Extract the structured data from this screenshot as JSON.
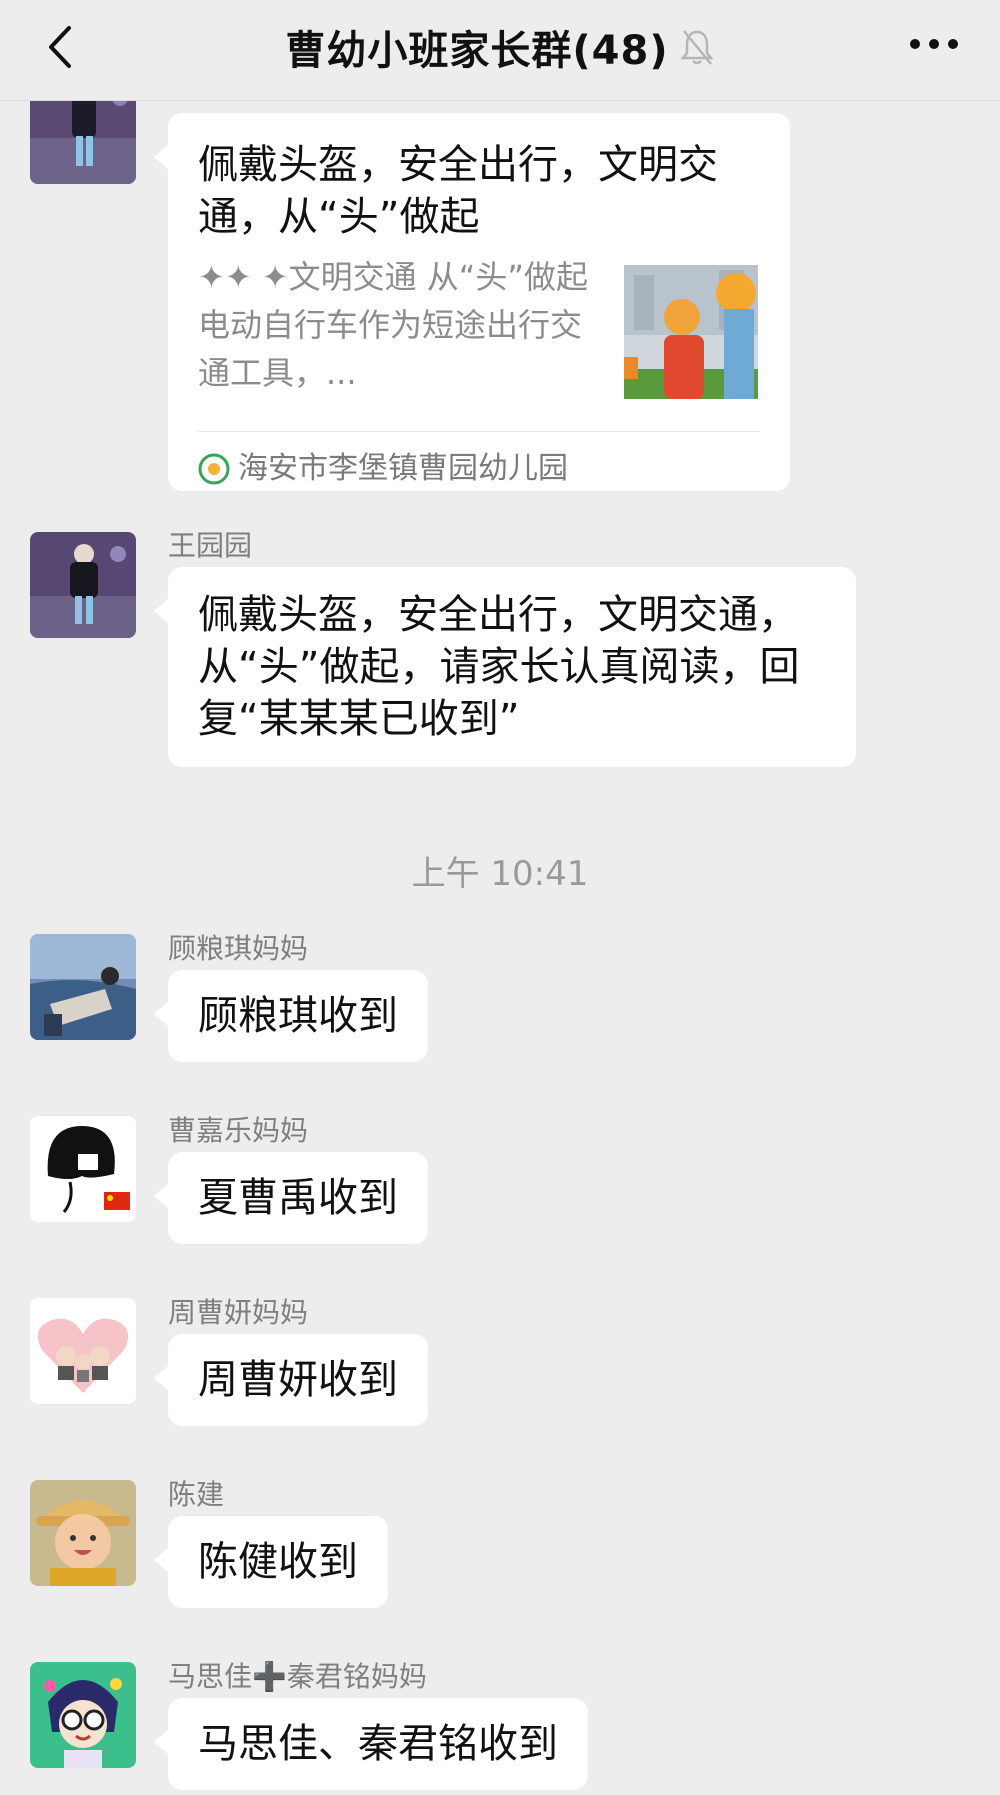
{
  "header": {
    "back_icon": "chevron-left-icon",
    "title": "曹幼小班家长群(48)",
    "mute_icon": "bell-muted-icon",
    "more_icon": "more-dots-icon"
  },
  "messages": [
    {
      "type": "link-card",
      "card_title": "佩戴头盔，安全出行，文明交通，从“头”做起",
      "card_desc": "✦✦ ✦文明交通  从“头”做起     电动自行车作为短途出行交通工具，...",
      "card_source": "海安市李堡镇曹园幼儿园"
    },
    {
      "type": "text",
      "nickname": "王园园",
      "text": "佩戴头盔，安全出行，文明交通，从“头”做起，请家长认真阅读，回复“某某某已收到”"
    },
    {
      "type": "time",
      "text": "上午 10:41"
    },
    {
      "type": "text",
      "nickname": "顾粮琪妈妈",
      "text": "顾粮琪收到"
    },
    {
      "type": "text",
      "nickname": "曹嘉乐妈妈",
      "text": "夏曹禹收到"
    },
    {
      "type": "text",
      "nickname": "周曹妍妈妈",
      "text": "周曹妍收到"
    },
    {
      "type": "text",
      "nickname": "陈建",
      "text": "陈健收到"
    },
    {
      "type": "text",
      "nickname": "马思佳➕秦君铭妈妈",
      "text": "马思佳、秦君铭收到"
    }
  ],
  "colors": {
    "background": "#ededed",
    "bubble": "#ffffff",
    "nickname": "#7f7f7f",
    "time": "#9a9a9a"
  }
}
